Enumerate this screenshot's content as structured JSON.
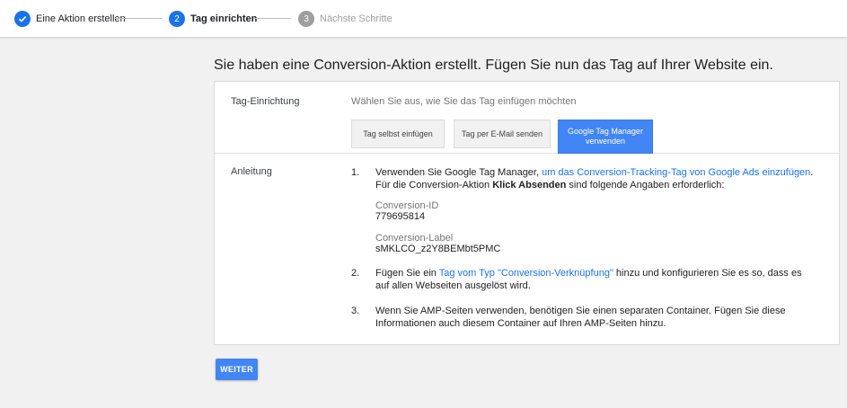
{
  "stepper": {
    "steps": [
      {
        "number": "",
        "label": "Eine Aktion erstellen",
        "state": "done"
      },
      {
        "number": "2",
        "label": "Tag einrichten",
        "state": "active"
      },
      {
        "number": "3",
        "label": "Nächste Schritte",
        "state": "inactive"
      }
    ]
  },
  "headline": "Sie haben eine Conversion-Aktion erstellt. Fügen Sie nun das Tag auf Ihrer Website ein.",
  "setup": {
    "label": "Tag-Einrichtung",
    "hint": "Wählen Sie aus, wie Sie das Tag einfügen möchten",
    "tabs": [
      {
        "label": "Tag selbst einfügen",
        "selected": false
      },
      {
        "label": "Tag per E-Mail senden",
        "selected": false
      },
      {
        "label": "Google Tag Manager verwenden",
        "selected": true
      }
    ]
  },
  "instructions": {
    "label": "Anleitung",
    "items": [
      {
        "num": "1.",
        "text_before": "Verwenden Sie Google Tag Manager, ",
        "link": "um das Conversion-Tracking-Tag von Google Ads einzufügen",
        "text_after": ". Für die Conversion-Aktion ",
        "bold": "Klick Absenden",
        "text_end": " sind folgende Angaben erforderlich:"
      },
      {
        "num": "2.",
        "text_before": "Fügen Sie ein ",
        "link": "Tag vom Typ \"Conversion-Verknüpfung\"",
        "text_after": " hinzu und konfigurieren Sie es so, dass es auf allen Webseiten ausgelöst wird."
      },
      {
        "num": "3.",
        "text": "Wenn Sie AMP-Seiten verwenden, benötigen Sie einen separaten Container. Fügen Sie diese Informationen auch diesem Container auf Ihren AMP-Seiten hinzu."
      }
    ],
    "conversion_id": {
      "label": "Conversion-ID",
      "value": "779695814"
    },
    "conversion_label": {
      "label": "Conversion-Label",
      "value": "sMKLCO_z2Y8BEMbt5PMC"
    }
  },
  "continue_label": "WEITER",
  "colors": {
    "accent": "#4285f4",
    "link": "#1a73e8",
    "inactive": "#9e9e9e"
  },
  "icons": {
    "step1": "check-icon"
  }
}
